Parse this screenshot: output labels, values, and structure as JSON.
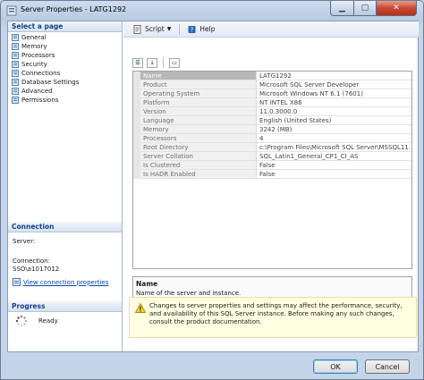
{
  "window": {
    "title": "Server Properties - LATG1292"
  },
  "left": {
    "select_page_header": "Select a page",
    "pages": [
      {
        "label": "General",
        "selected": true
      },
      {
        "label": "Memory"
      },
      {
        "label": "Processors"
      },
      {
        "label": "Security"
      },
      {
        "label": "Connections"
      },
      {
        "label": "Database Settings"
      },
      {
        "label": "Advanced"
      },
      {
        "label": "Permissions"
      }
    ],
    "connection_header": "Connection",
    "server_label": "Server:",
    "connection_label": "Connection:",
    "connection_value": "SSO\\a1017012",
    "view_link": "View connection properties",
    "progress_header": "Progress",
    "progress_status": "Ready"
  },
  "toolbar": {
    "script_label": "Script",
    "help_label": "Help"
  },
  "properties": [
    {
      "name": "Name",
      "value": "LATG1292",
      "selected": true
    },
    {
      "name": "Product",
      "value": "Microsoft SQL Server Developer"
    },
    {
      "name": "Operating System",
      "value": "Microsoft Windows NT 6.1 (7601)"
    },
    {
      "name": "Platform",
      "value": "NT INTEL X86"
    },
    {
      "name": "Version",
      "value": "11.0.3000.0"
    },
    {
      "name": "Language",
      "value": "English (United States)"
    },
    {
      "name": "Memory",
      "value": "3242 (MB)"
    },
    {
      "name": "Processors",
      "value": "4"
    },
    {
      "name": "Root Directory",
      "value": "c:\\Program Files\\Microsoft SQL Server\\MSSQL11."
    },
    {
      "name": "Server Collation",
      "value": "SQL_Latin1_General_CP1_CI_AS"
    },
    {
      "name": "Is Clustered",
      "value": "False"
    },
    {
      "name": "Is HADR Enabled",
      "value": "False"
    }
  ],
  "description": {
    "title": "Name",
    "text": "Name of the server and instance."
  },
  "warning": {
    "text": "Changes to server properties and settings may affect the performance, security, and availability of this SQL Server instance. Before making any such changes, consult the product documentation."
  },
  "buttons": {
    "ok": "OK",
    "cancel": "Cancel"
  },
  "colors": {
    "title_gradient": "#b9cbe3",
    "close_red": "#c74a32",
    "link": "#0645ad",
    "warning_bg": "#ffffe1"
  }
}
